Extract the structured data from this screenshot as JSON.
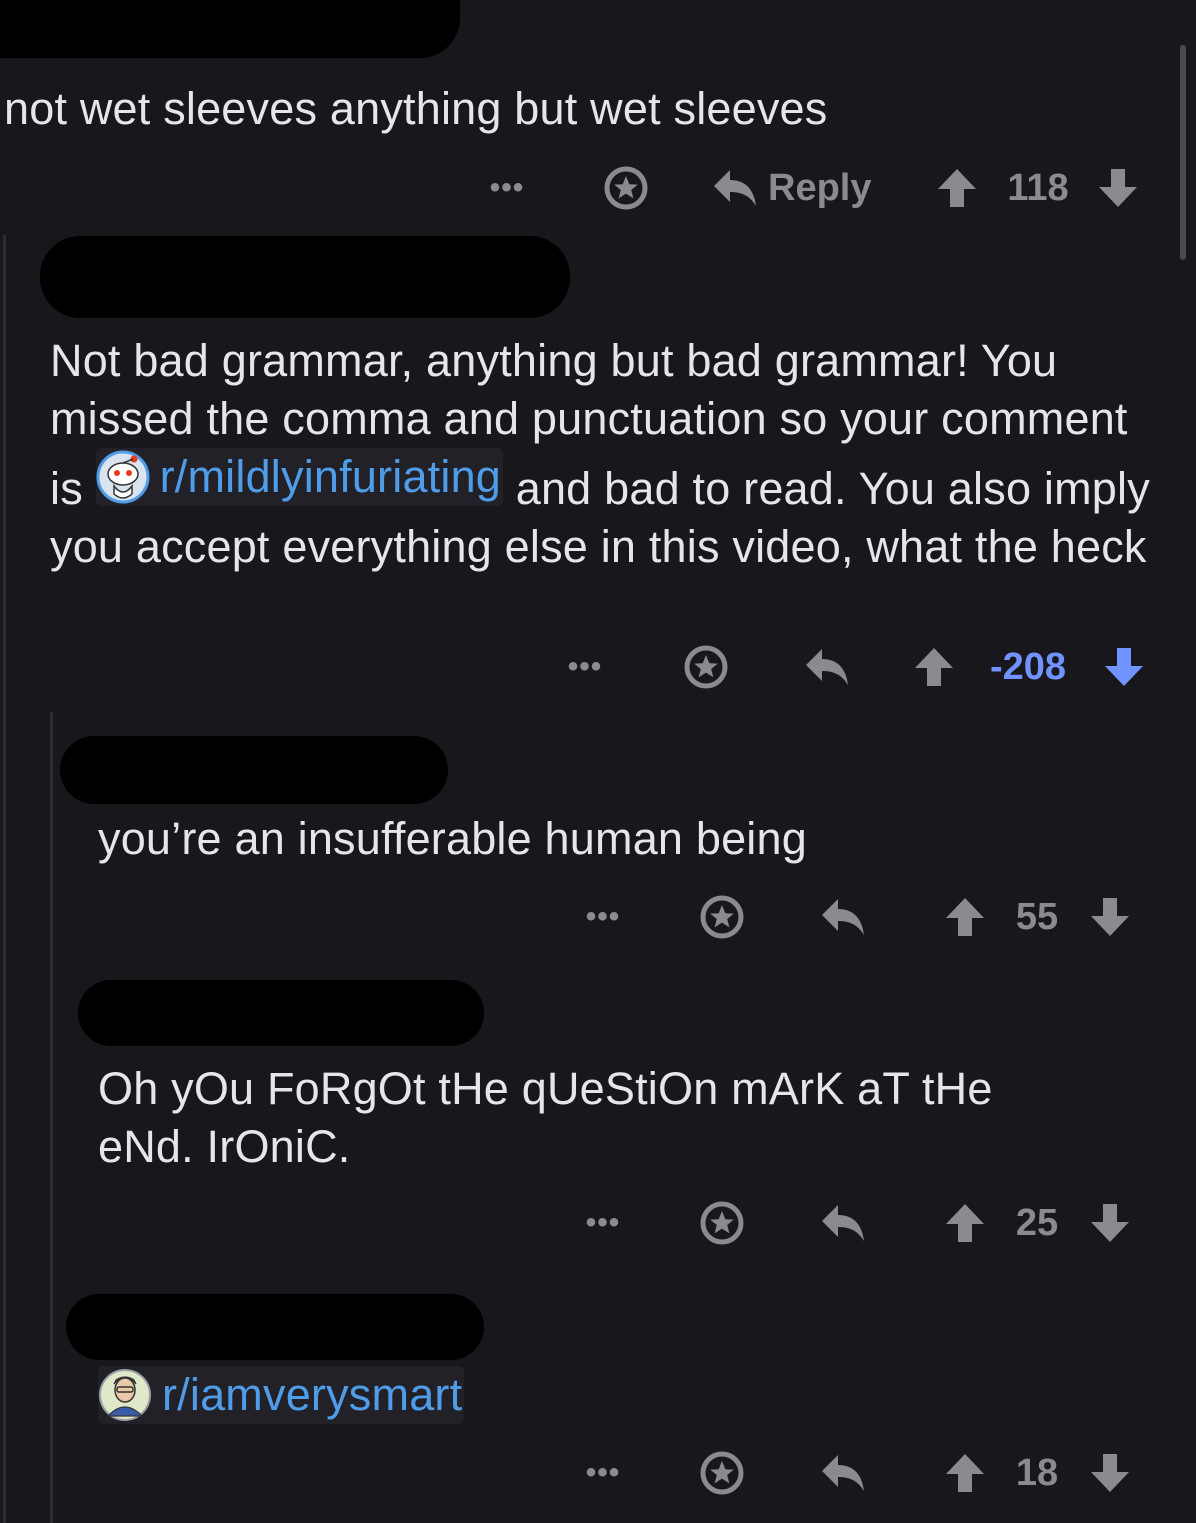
{
  "comments": [
    {
      "body": "not wet sleeves anything but wet sleeves",
      "more_label": "•••",
      "reply_label": "Reply",
      "score": "118",
      "vote_state": "none"
    },
    {
      "body_before_link": "Not bad grammar, anything but bad grammar! You missed the comma and punctuation so your comment is ",
      "subreddit_link": "r/mildlyinfuriating",
      "body_after_link": " and bad to read. You also imply you accept everything else in this video, what the heck",
      "more_label": "•••",
      "score": "-208",
      "vote_state": "downvoted"
    },
    {
      "body": "you’re an insufferable human being",
      "more_label": "•••",
      "score": "55",
      "vote_state": "none"
    },
    {
      "body": "Oh yOu FoRgOt tHe qUeStiOn mArK aT tHe eNd. IrOniC.",
      "more_label": "•••",
      "score": "25",
      "vote_state": "none"
    },
    {
      "subreddit_link": "r/iamverysmart",
      "more_label": "•••",
      "score": "18",
      "vote_state": "none"
    }
  ],
  "colors": {
    "background": "#18171c",
    "text": "#e6e6e8",
    "action": "#8a8a8f",
    "downvote": "#7193ff",
    "link": "#4f9de8"
  },
  "icons": [
    "star-icon",
    "reply-icon",
    "upvote-arrow-icon",
    "downvote-arrow-icon",
    "subreddit-snoo-icon",
    "subreddit-avatar-icon"
  ]
}
